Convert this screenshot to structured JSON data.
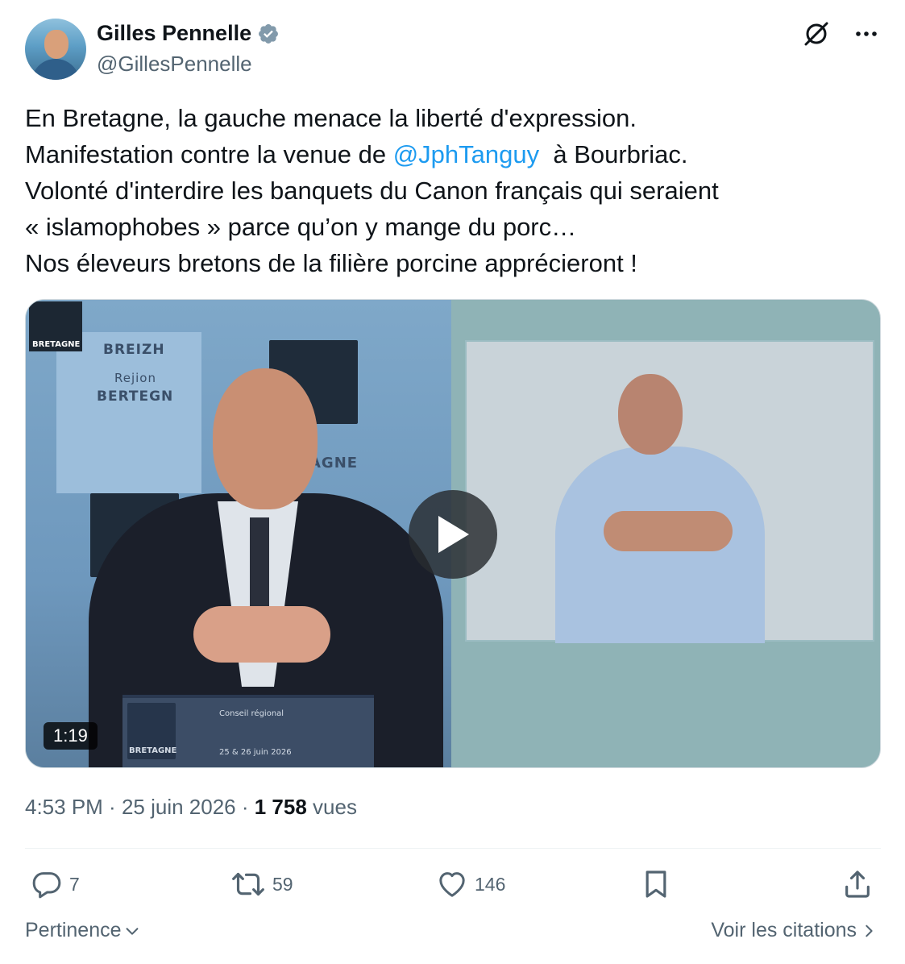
{
  "author": {
    "name": "Gilles Pennelle",
    "handle": "@GillesPennelle",
    "verified_icon": "verified-badge-icon"
  },
  "header_icons": [
    "grok-icon",
    "more-icon"
  ],
  "tweet": {
    "line1": "En Bretagne, la gauche menace la liberté d'expression.",
    "line2_before": "Manifestation contre la venue de ",
    "mention": "@JphTanguy",
    "line2_after": "  à Bourbriac.",
    "line3": "Volonté d'interdire les banquets du Canon français qui seraient",
    "line4": "« islamophobes » parce qu’on y mange du porc…",
    "line5": "Nos éleveurs bretons de la filière porcine apprécieront !"
  },
  "video": {
    "duration": "1:19",
    "play_icon": "play-icon",
    "scene_text": {
      "corner_logo": "BRETAGNE",
      "backdrop_line1": "BREIZH",
      "backdrop_line2": "Rejion",
      "backdrop_line3": "BERTEGN",
      "backdrop_line4": "AGNE",
      "lectern_line1": "Conseil régional",
      "lectern_line2": "25 & 26 juin 2026",
      "lectern_logo": "BRETAGNE"
    }
  },
  "meta": {
    "time": "4:53 PM",
    "separator": " · ",
    "date": "25 juin 2026",
    "views_count": "1 758",
    "views_label": " vues"
  },
  "actions": {
    "replies": "7",
    "reposts": "59",
    "likes": "146"
  },
  "footer": {
    "sort_label": "Pertinence",
    "quotes_label": "Voir les citations"
  },
  "colors": {
    "text": "#0f1419",
    "secondary": "#536471",
    "link": "#1d9bf0",
    "verified": "#829aab"
  }
}
